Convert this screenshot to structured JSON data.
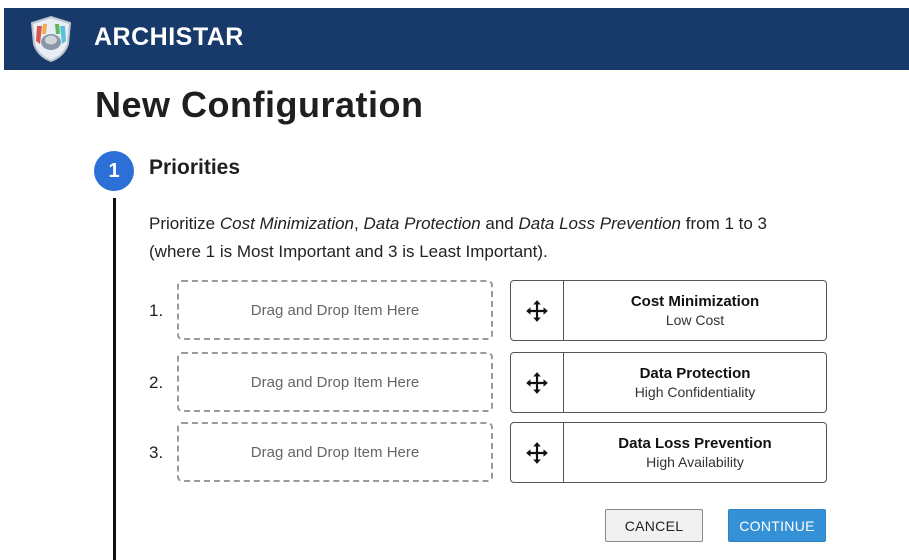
{
  "header": {
    "brand": "ARCHISTAR",
    "logo_icon": "shield-logo-icon"
  },
  "page": {
    "title": "New Configuration"
  },
  "step": {
    "number": "1",
    "title": "Priorities",
    "instructions": {
      "p1": "Prioritize ",
      "em1": "Cost Minimization",
      "p2": ", ",
      "em2": "Data Protection",
      "p3": " and ",
      "em3": "Data Loss Prevention",
      "p4": " from 1 to 3",
      "line2": "(where 1 is Most Important and 3 is Least Important)."
    }
  },
  "slots": [
    {
      "rank": "1.",
      "placeholder": "Drag and Drop Item Here"
    },
    {
      "rank": "2.",
      "placeholder": "Drag and Drop Item Here"
    },
    {
      "rank": "3.",
      "placeholder": "Drag and Drop Item Here"
    }
  ],
  "items": [
    {
      "title": "Cost Minimization",
      "subtitle": "Low Cost",
      "icon": "move-icon"
    },
    {
      "title": "Data Protection",
      "subtitle": "High Confidentiality",
      "icon": "move-icon"
    },
    {
      "title": "Data Loss Prevention",
      "subtitle": "High Availability",
      "icon": "move-icon"
    }
  ],
  "buttons": {
    "cancel": "CANCEL",
    "continue": "CONTINUE"
  },
  "colors": {
    "header_bg": "#173a6b",
    "step_circle": "#2c6fd6",
    "continue_bg": "#3591d6"
  }
}
